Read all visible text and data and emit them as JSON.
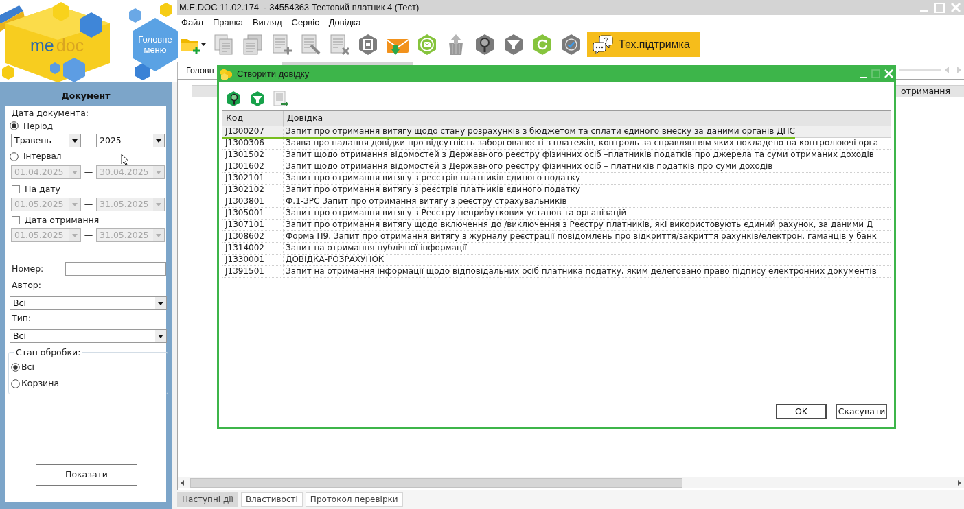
{
  "logo": {
    "prefix": "me",
    "suffix": "doc"
  },
  "main_menu_button": {
    "label": "Головне меню"
  },
  "window": {
    "title": "M.E.DOC 11.02.174  - 34554363 Тестовий платник 4 (Тест)"
  },
  "menu": [
    "Файл",
    "Правка",
    "Вигляд",
    "Сервіс",
    "Довідка"
  ],
  "support_button": {
    "label": "Тех.підтримка"
  },
  "document_tabs": [
    {
      "label": "Головн",
      "selected": true
    },
    {
      "selected": false
    }
  ],
  "background_table": {
    "column_header": "отримання"
  },
  "filter_panel": {
    "title": "Документ",
    "date_label": "Дата документа:",
    "period": {
      "label": "Період",
      "selected": true,
      "month": "Травень",
      "year": "2025"
    },
    "interval": {
      "label": "Інтервал",
      "selected": false,
      "disabled": true,
      "from": "01.04.2025",
      "separator": "—",
      "to": "30.04.2025"
    },
    "on_date": {
      "label": "На дату",
      "checked": false,
      "disabled": true,
      "from": "01.05.2025",
      "separator": "—",
      "to": "31.05.2025"
    },
    "received_date": {
      "label": "Дата отримання",
      "checked": false,
      "disabled": true,
      "from": "01.05.2025",
      "separator": "—",
      "to": "31.05.2025"
    },
    "number": {
      "label": "Номер:"
    },
    "author": {
      "label": "Автор:",
      "value": "Всі"
    },
    "type": {
      "label": "Тип:",
      "value": "Всі"
    },
    "processing_state": {
      "label": "Стан обробки:",
      "options": [
        {
          "label": "Всі",
          "selected": true
        },
        {
          "label": "Корзина",
          "selected": false
        }
      ]
    },
    "show_button": {
      "label": "Показати"
    }
  },
  "dialog": {
    "title": "Створити довідку",
    "table": {
      "columns": [
        "Код",
        "Довідка"
      ],
      "rows": [
        {
          "code": "J1300207",
          "name": "Запит про отримання витягу щодо стану розрахунків з бюджетом та сплати єдиного внеску за даними органів ДПС",
          "selected": true
        },
        {
          "code": "J1300306",
          "name": "Заява про надання довідки про відсутність заборгованості з платежів, контроль за справлянням яких покладено на контролюючі орга",
          "selected": false
        },
        {
          "code": "J1301502",
          "name": "Запит щодо отримання відомостей з Державного реєстру фізичних осіб –платників податків про джерела та суми отриманих доходів",
          "selected": false
        },
        {
          "code": "J1301602",
          "name": "Запит щодо отримання відомостей з Державного реєстру фізичних осіб – платників податків про суми доходів",
          "selected": false
        },
        {
          "code": "J1302101",
          "name": "Запит про отримання витягу з реєстрів платників єдиного податку",
          "selected": false
        },
        {
          "code": "J1302102",
          "name": "Запит про отримання витягу з реєстрів платників єдиного податку",
          "selected": false
        },
        {
          "code": "J1303801",
          "name": "Ф.1-ЗРС Запит про отримання витягу з реєстру страхувальників",
          "selected": false
        },
        {
          "code": "J1305001",
          "name": "Запит про отримання витягу з Реєстру неприбуткових установ та організацій",
          "selected": false
        },
        {
          "code": "J1307101",
          "name": "Запит про отримання витягу щодо включення до /виключення з Реєстру платників, які використовують єдиний рахунок, за даними Д",
          "selected": false
        },
        {
          "code": "J1308602",
          "name": "Форма П9. Запит про отримання витягу з журналу реєстрації повідомлень про відкриття/закриття рахунків/електрон. гаманців у банк",
          "selected": false
        },
        {
          "code": "J1314002",
          "name": "Запит на отримання публічної інформації",
          "selected": false
        },
        {
          "code": "J1330001",
          "name": "ДОВІДКА-РОЗРАХУНОК",
          "selected": false
        },
        {
          "code": "J1391501",
          "name": "Запит на отримання інформації щодо відповідальних осіб платника податку, яким делеговано право підпису електронних документів",
          "selected": false
        }
      ]
    },
    "buttons": [
      {
        "label": "OK",
        "default": true
      },
      {
        "label": "Скасувати",
        "default": false
      }
    ]
  },
  "bottom_tabs": [
    {
      "label": "Наступні дії",
      "selected": true
    },
    {
      "label": "Властивості",
      "selected": false
    },
    {
      "label": "Протокол перевірки",
      "selected": false
    }
  ]
}
